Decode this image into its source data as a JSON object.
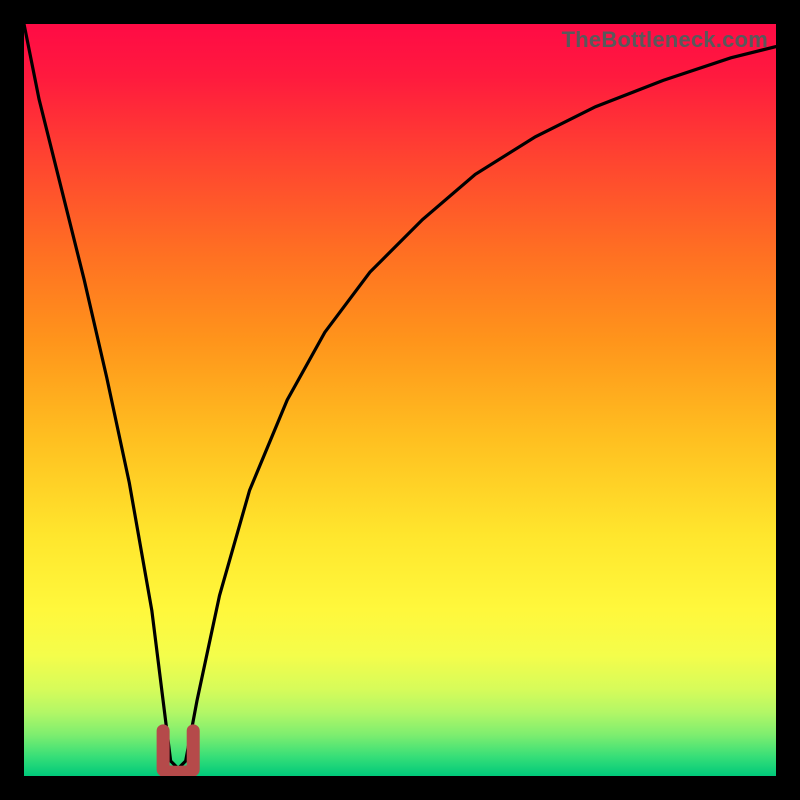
{
  "watermark": "TheBottleneck.com",
  "chart_data": {
    "type": "line",
    "title": "",
    "xlabel": "",
    "ylabel": "",
    "xlim": [
      0,
      100
    ],
    "ylim": [
      0,
      100
    ],
    "grid": false,
    "series": [
      {
        "name": "bottleneck-curve",
        "x": [
          0,
          2,
          5,
          8,
          11,
          14,
          17,
          18.5,
          19.5,
          20.5,
          21.5,
          23,
          26,
          30,
          35,
          40,
          46,
          53,
          60,
          68,
          76,
          85,
          94,
          100
        ],
        "y": [
          100,
          90,
          78,
          66,
          53,
          39,
          22,
          10,
          2,
          1,
          2,
          10,
          24,
          38,
          50,
          59,
          67,
          74,
          80,
          85,
          89,
          92.5,
          95.5,
          97
        ]
      }
    ],
    "cusp": {
      "x": 20.5,
      "y_top": 6,
      "y_bottom": 0.5,
      "width": 4
    },
    "background_gradient": {
      "stops": [
        {
          "offset": 0.0,
          "color": "#ff0b45"
        },
        {
          "offset": 0.07,
          "color": "#ff1a3e"
        },
        {
          "offset": 0.18,
          "color": "#ff4430"
        },
        {
          "offset": 0.3,
          "color": "#ff6e23"
        },
        {
          "offset": 0.42,
          "color": "#ff941b"
        },
        {
          "offset": 0.55,
          "color": "#ffbf20"
        },
        {
          "offset": 0.68,
          "color": "#ffe62d"
        },
        {
          "offset": 0.78,
          "color": "#fff83c"
        },
        {
          "offset": 0.84,
          "color": "#f4fd4b"
        },
        {
          "offset": 0.885,
          "color": "#d6fb5a"
        },
        {
          "offset": 0.915,
          "color": "#b3f766"
        },
        {
          "offset": 0.945,
          "color": "#7eee6f"
        },
        {
          "offset": 0.975,
          "color": "#35de78"
        },
        {
          "offset": 1.0,
          "color": "#00c97a"
        }
      ]
    }
  }
}
